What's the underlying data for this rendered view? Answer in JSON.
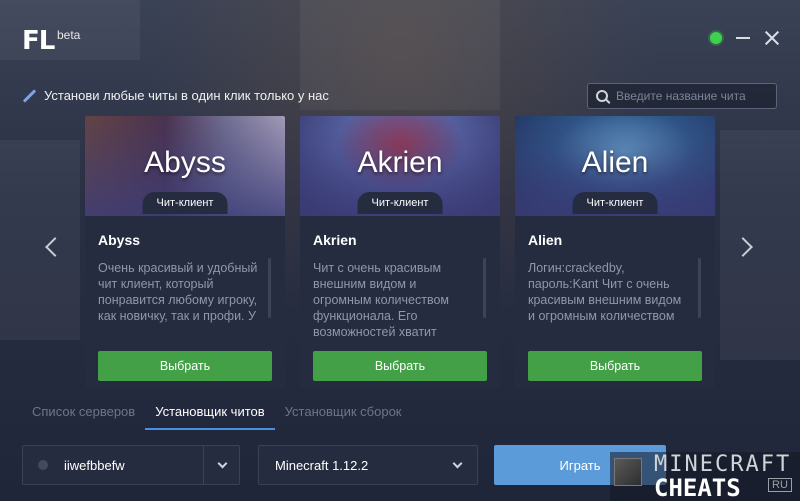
{
  "app": {
    "logo": "FL",
    "badge": "beta"
  },
  "header": {
    "promo": "Установи любые читы в один клик только у нас",
    "search_placeholder": "Введите название чита"
  },
  "cards": [
    {
      "banner": "Abyss",
      "badge": "Чит-клиент",
      "title": "Abyss",
      "description": "Очень красивый и удобный чит клиент, который понравится любому игроку, как новичку, так и профи. У",
      "button": "Выбрать"
    },
    {
      "banner": "Akrien",
      "badge": "Чит-клиент",
      "title": "Akrien",
      "description": "Чит с очень красивым внешним видом и огромным количеством функционала. Его возможностей хватит",
      "button": "Выбрать"
    },
    {
      "banner": "Alien",
      "badge": "Чит-клиент",
      "title": "Alien",
      "description": "Логин:crackedby, пароль:Kant Чит с очень красивым внешним видом и огромным количеством",
      "button": "Выбрать"
    }
  ],
  "tabs": [
    "Список серверов",
    "Установщик читов",
    "Установщик сборок"
  ],
  "account": {
    "name": "iiwefbbefw"
  },
  "version": {
    "selected": "Minecraft 1.12.2"
  },
  "play_button": "Играть",
  "watermark": {
    "line1": "MINECRAFT",
    "line2": "CHEATS",
    "ru": "RU"
  },
  "colors": {
    "accent": "#4a90e2",
    "choose": "#43a047",
    "online": "#3dd24e"
  }
}
